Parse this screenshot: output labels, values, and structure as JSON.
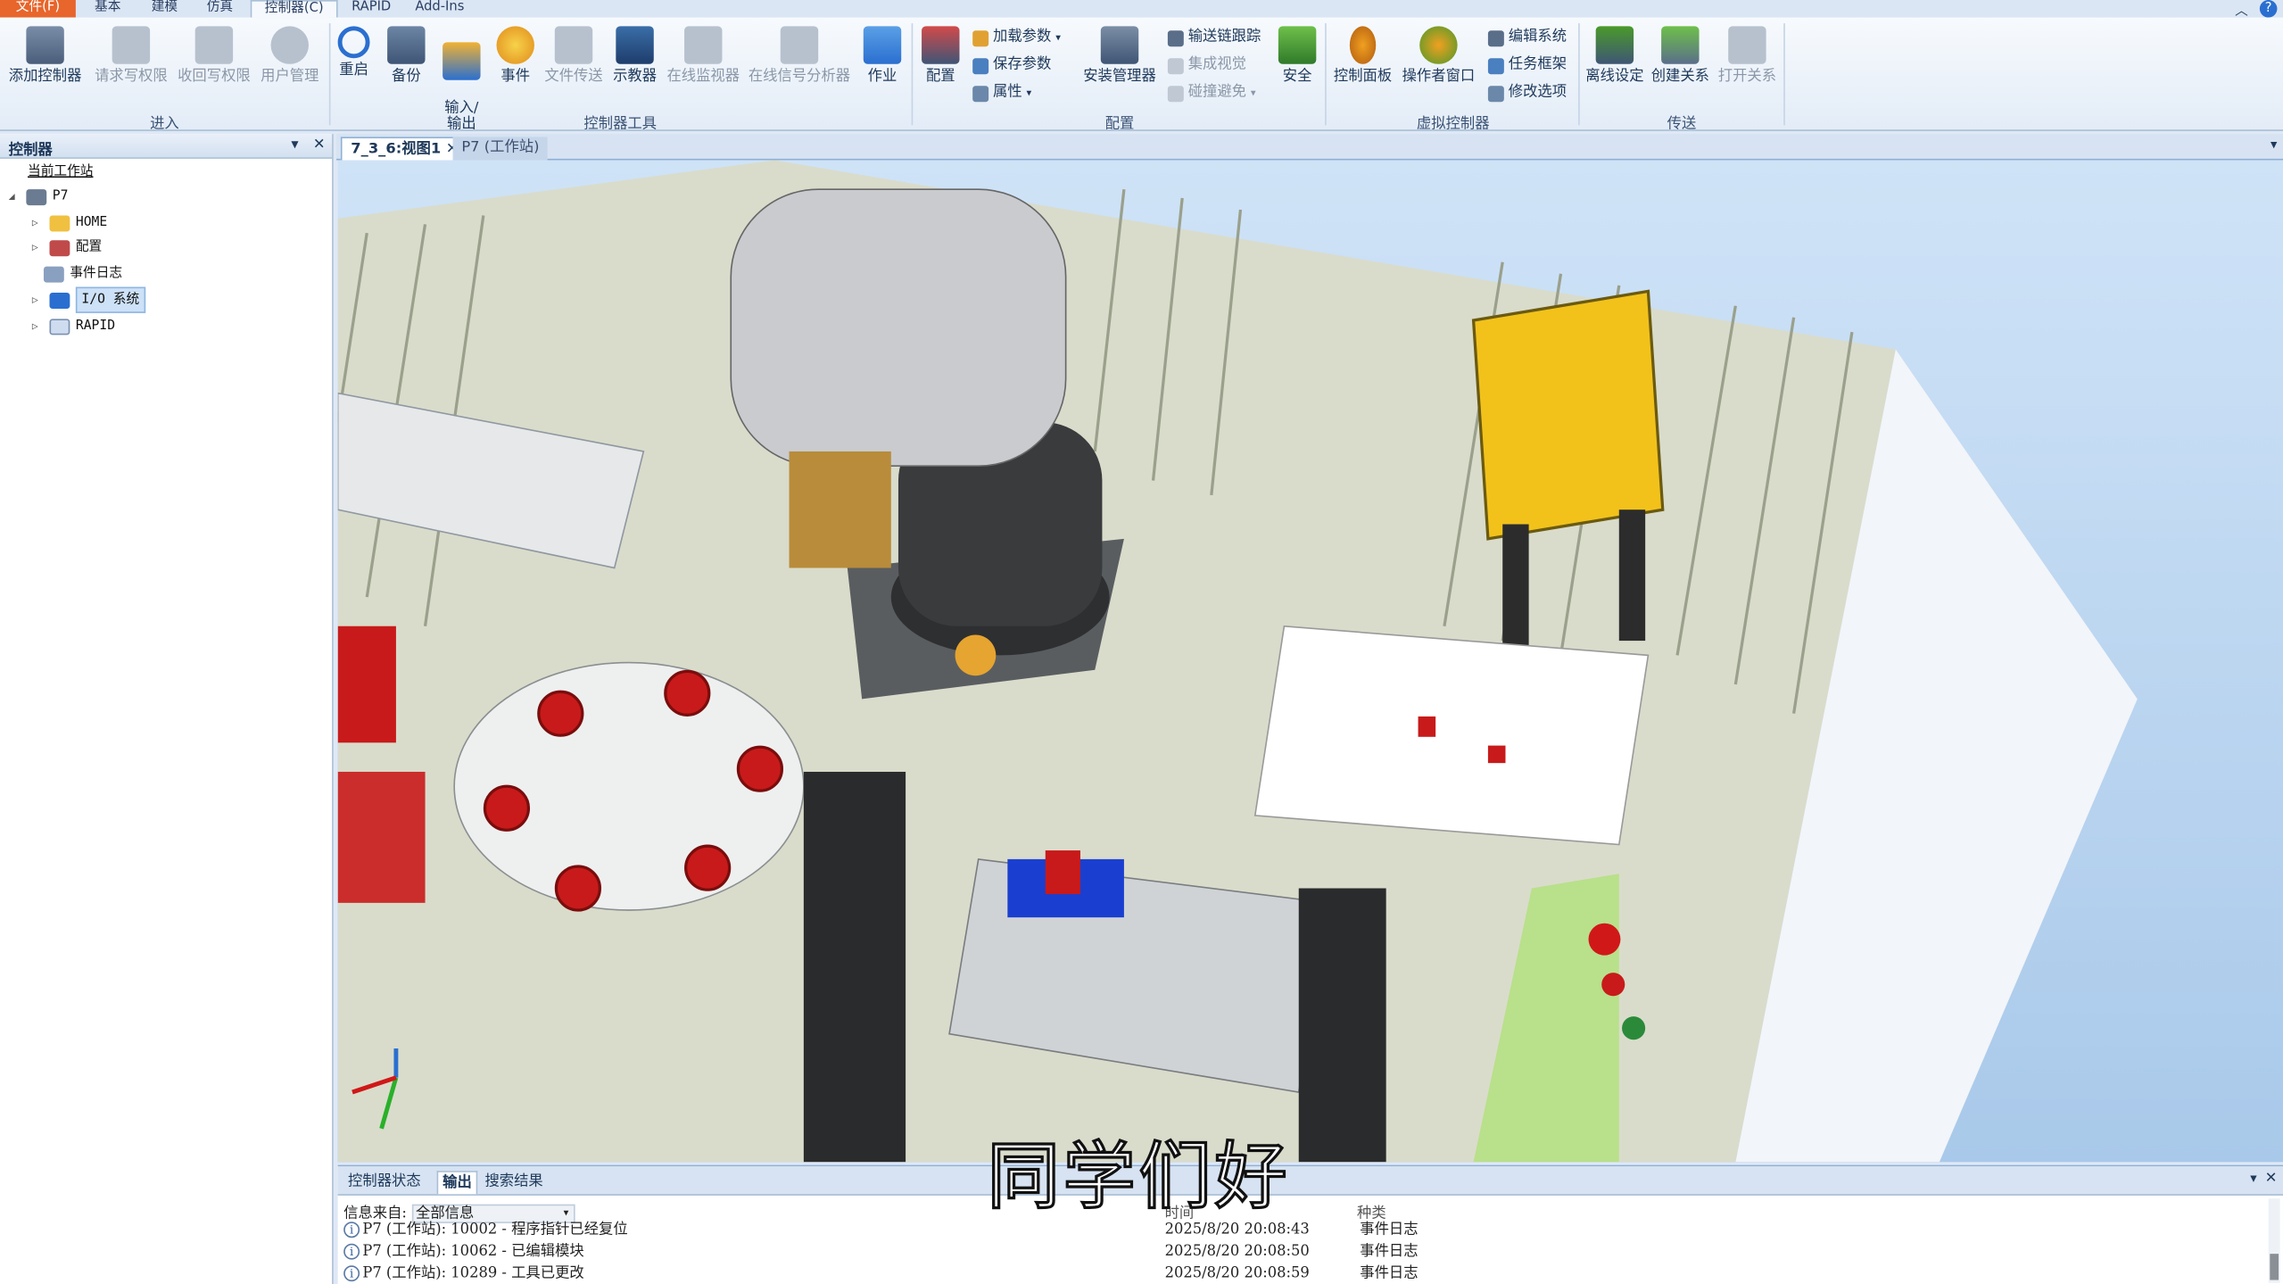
{
  "ribbon_tabs": [
    "文件(F)",
    "基本",
    "建模",
    "仿真",
    "控制器(C)",
    "RAPID",
    "Add-Ins"
  ],
  "ribbon": {
    "enter_group": {
      "label": "进入",
      "buttons": [
        "添加控制器",
        "请求写权限",
        "收回写权限",
        "用户管理"
      ]
    },
    "tools_group": {
      "label": "控制器工具",
      "buttons": [
        "重启",
        "备份",
        "输入/\n输出",
        "事件",
        "文件传送",
        "示教器",
        "在线监视器",
        "在线信号分析器",
        "作业"
      ]
    },
    "config_group": {
      "label": "配置",
      "buttons": [
        "配置",
        "安装管理器",
        "安全"
      ],
      "small": [
        "加载参数",
        "保存参数",
        "属性",
        "输送链跟踪",
        "集成视觉",
        "碰撞避免"
      ]
    },
    "virtual_group": {
      "label": "虚拟控制器",
      "buttons": [
        "控制面板",
        "操作者窗口"
      ],
      "small": [
        "编辑系统",
        "任务框架",
        "修改选项"
      ]
    },
    "transfer_group": {
      "label": "传送",
      "buttons": [
        "离线设定",
        "创建关系",
        "打开关系"
      ]
    }
  },
  "left_panel": {
    "title": "控制器",
    "station_label": "当前工作站",
    "tree": [
      "P7",
      "HOME",
      "配置",
      "事件日志",
      "I/O 系统",
      "RAPID"
    ]
  },
  "doc_tabs": [
    "7_3_6:视图1",
    "P7 (工作站)"
  ],
  "caption": "同学们好",
  "output": {
    "tabs": [
      "控制器状态",
      "输出",
      "搜索结果"
    ],
    "filter_label": "信息来自:",
    "filter_value": "全部信息",
    "headers": {
      "time": "时间",
      "category": "种类"
    },
    "rows": [
      {
        "msg": "P7 (工作站): 10002 - 程序指针已经复位",
        "time": "2025/8/20 20:08:43",
        "cat": "事件日志"
      },
      {
        "msg": "P7 (工作站): 10062 - 已编辑模块",
        "time": "2025/8/20 20:08:50",
        "cat": "事件日志"
      },
      {
        "msg": "P7 (工作站): 10289 - 工具已更改",
        "time": "2025/8/20 20:08:59",
        "cat": "事件日志"
      }
    ]
  },
  "colors": {
    "accent": "#e8652b",
    "frame": "#dfe8f5",
    "robot": "#3a3a3a",
    "fixture_yellow": "#f2c21b",
    "part_red": "#c81a1a",
    "part_blue": "#1a3fd0"
  }
}
